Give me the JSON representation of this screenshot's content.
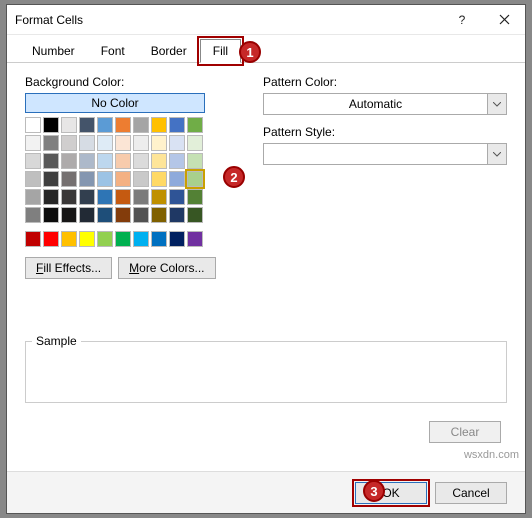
{
  "title": "Format Cells",
  "tabs": [
    "Number",
    "Font",
    "Border",
    "Fill"
  ],
  "selectedTab": 3,
  "labels": {
    "background": "Background Color:",
    "noColor": "No Color",
    "fillEffects": "Fill Effects...",
    "moreColors": "More Colors...",
    "patternColor": "Pattern Color:",
    "patternStyle": "Pattern Style:",
    "automatic": "Automatic",
    "sample": "Sample",
    "clear": "Clear",
    "ok": "OK",
    "cancel": "Cancel"
  },
  "palette": {
    "rows": [
      [
        "#ffffff",
        "#000000",
        "#e7e6e6",
        "#44546a",
        "#5b9bd5",
        "#ed7d31",
        "#a5a5a5",
        "#ffc000",
        "#4472c4",
        "#70ad47"
      ],
      [
        "#f2f2f2",
        "#7f7f7f",
        "#d0cece",
        "#d6dce4",
        "#deebf6",
        "#fbe5d5",
        "#ededed",
        "#fff2cc",
        "#d9e2f3",
        "#e2efd9"
      ],
      [
        "#d8d8d8",
        "#595959",
        "#aeabab",
        "#adb9ca",
        "#bdd7ee",
        "#f7cbac",
        "#dbdbdb",
        "#fee599",
        "#b4c6e7",
        "#c5e0b3"
      ],
      [
        "#bfbfbf",
        "#3f3f3f",
        "#757070",
        "#8496b0",
        "#9cc3e5",
        "#f4b183",
        "#c9c9c9",
        "#ffd965",
        "#8eaadb",
        "#a8d08d"
      ],
      [
        "#a5a5a5",
        "#262626",
        "#3a3838",
        "#323f4f",
        "#2e75b5",
        "#c55a11",
        "#7b7b7b",
        "#bf9000",
        "#2f5496",
        "#538135"
      ],
      [
        "#7f7f7f",
        "#0c0c0c",
        "#171616",
        "#222a35",
        "#1e4e79",
        "#833c0b",
        "#525252",
        "#7f6000",
        "#1f3864",
        "#375623"
      ]
    ],
    "standard": [
      "#c00000",
      "#ff0000",
      "#ffc000",
      "#ffff00",
      "#92d050",
      "#00b050",
      "#00b0f0",
      "#0070c0",
      "#002060",
      "#7030a0"
    ],
    "selected": {
      "row": 3,
      "col": 9
    }
  },
  "callouts": {
    "c1": "1",
    "c2": "2",
    "c3": "3"
  },
  "watermark": "wsxdn.com"
}
